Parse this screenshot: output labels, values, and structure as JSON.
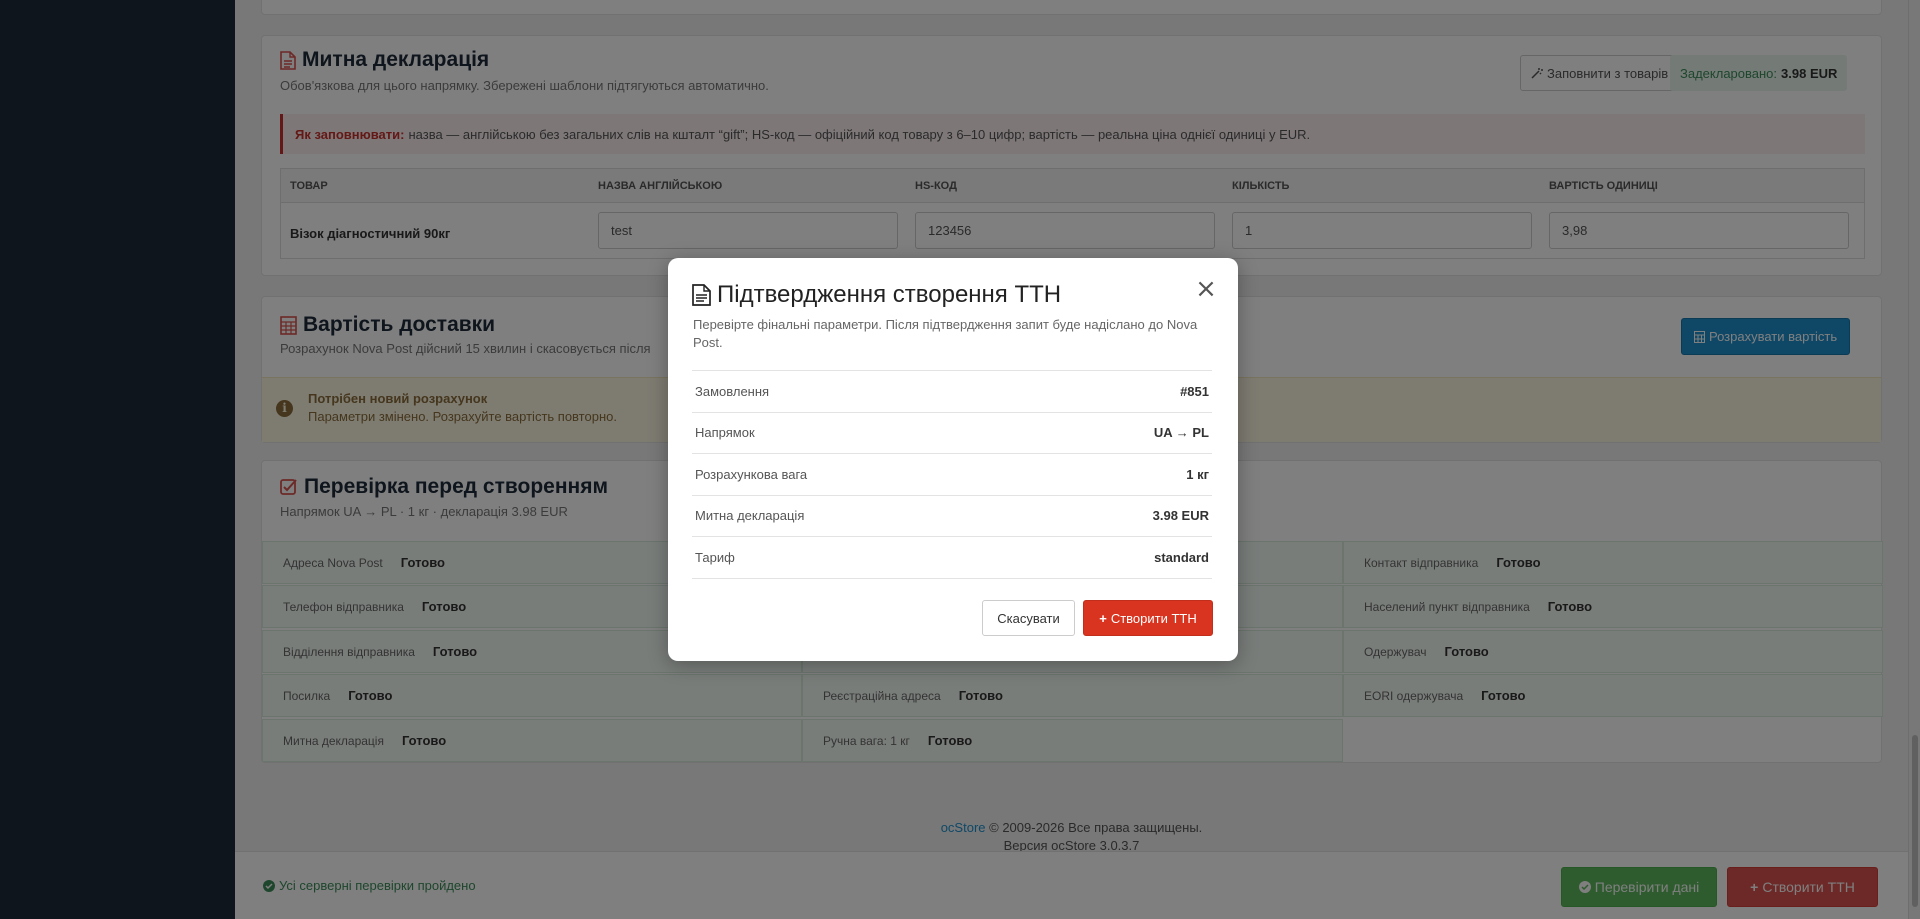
{
  "customs": {
    "title": "Митна декларація",
    "subtitle": "Обов'язкова для цього напрямку. Збережені шаблони підтягуються автоматично.",
    "fill_button": "Заповнити з товарів",
    "declared_label": "Задекларовано:",
    "declared_value": "3.98 EUR",
    "hint_label": "Як заповнювати:",
    "hint_text": "назва — англійською без загальних слів на кшталт “gift”; HS-код — офіційний код товару з 6–10 цифр; вартість — реальна ціна однієї одиниці у EUR.",
    "columns": [
      "ТОВАР",
      "НАЗВА АНГЛІЙСЬКОЮ",
      "HS-КОД",
      "КІЛЬКІСТЬ",
      "ВАРТІСТЬ ОДИНИЦІ"
    ],
    "row": {
      "product": "Візок діагностичний 90кг",
      "name_en": "test",
      "hs_code": "123456",
      "qty": "1",
      "unit_price": "3,98"
    }
  },
  "shipping": {
    "title": "Вартість доставки",
    "subtitle": "Розрахунок Nova Post дійсний 15 хвилин і скасовується після",
    "calc_button": "Розрахувати вартість",
    "warn_title": "Потрібен новий розрахунок",
    "warn_text": "Параметри змінено. Розрахуйте вартість повторно."
  },
  "checks": {
    "title": "Перевірка перед створенням",
    "subtitle": "Напрямок UA → PL · 1 кг · декларація 3.98 EUR",
    "items": [
      {
        "label": "Адреса Nova Post",
        "status": "Готово"
      },
      {
        "label": "Контакт відправника",
        "status": "Готово"
      },
      {
        "label": "Телефон відправника",
        "status": "Готово"
      },
      {
        "label": "Населений пункт відправника",
        "status": "Готово"
      },
      {
        "label": "Відділення відправника",
        "status": "Готово"
      },
      {
        "label": "Одержувач",
        "status": "Готово"
      },
      {
        "label": "Посилка",
        "status": "Готово"
      },
      {
        "label": "Реєстраційна адреса",
        "status": "Готово"
      },
      {
        "label": "EORI одержувача",
        "status": "Готово"
      },
      {
        "label": "Митна декларація",
        "status": "Готово"
      },
      {
        "label": "Ручна вага: 1 кг",
        "status": "Готово"
      }
    ]
  },
  "footer": {
    "link": "ocStore",
    "copyright": "© 2009-2026 Все права защищены.",
    "version": "Версия ocStore 3.0.3.7",
    "server_ok": "Усі серверні перевірки пройдено",
    "check_button": "Перевірити дані",
    "create_button": "Створити ТТН"
  },
  "modal": {
    "title": "Підтвердження створення ТТН",
    "subtitle": "Перевірте фінальні параметри. Після підтвердження запит буде надіслано до Nova Post.",
    "rows": [
      {
        "key": "Замовлення",
        "value": "#851"
      },
      {
        "key": "Напрямок",
        "value": "UA → PL"
      },
      {
        "key": "Розрахункова вага",
        "value": "1 кг"
      },
      {
        "key": "Митна декларація",
        "value": "3.98 EUR"
      },
      {
        "key": "Тариф",
        "value": "standard"
      }
    ],
    "cancel": "Скасувати",
    "confirm": "Створити ТТН"
  },
  "colors": {
    "sidebar": "#1e2a38",
    "primary": "#1e91cf",
    "danger": "#d9341f",
    "success": "#5cb85c"
  },
  "icons": [
    "file-icon",
    "calculator-icon",
    "check-square-icon",
    "magic-icon",
    "info-icon",
    "check-circle-icon",
    "plus-icon",
    "close-icon"
  ]
}
